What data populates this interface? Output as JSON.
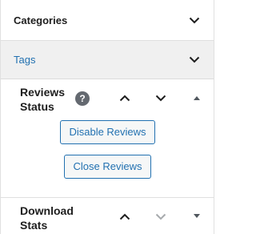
{
  "panels": {
    "categories": {
      "title": "Categories"
    },
    "tags": {
      "title": "Tags"
    }
  },
  "reviews_status": {
    "title": "Reviews Status",
    "help_icon_glyph": "?",
    "disable_button": "Disable Reviews",
    "close_button": "Close Reviews"
  },
  "download_stats": {
    "title": "Download Stats"
  },
  "icons": {
    "panel_toggle": "chevron-down-icon",
    "move_up": "chevron-up-icon",
    "move_down": "chevron-down-icon",
    "box_toggle": "triangle-icon"
  },
  "colors": {
    "link_blue": "#2271b1",
    "tags_bg": "#f0f0f0",
    "muted_icon": "#a7aaad"
  }
}
